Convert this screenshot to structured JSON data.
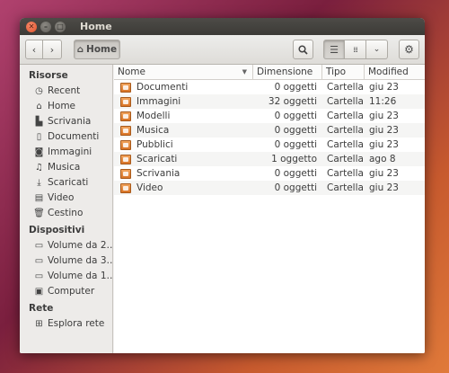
{
  "window": {
    "title": "Home"
  },
  "toolbar": {
    "location_label": "Home"
  },
  "sidebar": {
    "sections": [
      {
        "title": "Risorse",
        "items": [
          {
            "label": "Recent",
            "icon": "clock-icon"
          },
          {
            "label": "Home",
            "icon": "home-icon"
          },
          {
            "label": "Scrivania",
            "icon": "desktop-icon"
          },
          {
            "label": "Documenti",
            "icon": "document-icon"
          },
          {
            "label": "Immagini",
            "icon": "camera-icon"
          },
          {
            "label": "Musica",
            "icon": "music-icon"
          },
          {
            "label": "Scaricati",
            "icon": "download-icon"
          },
          {
            "label": "Video",
            "icon": "film-icon"
          },
          {
            "label": "Cestino",
            "icon": "trash-icon"
          }
        ]
      },
      {
        "title": "Dispositivi",
        "items": [
          {
            "label": "Volume da 2…",
            "icon": "drive-icon"
          },
          {
            "label": "Volume da 3…",
            "icon": "drive-icon"
          },
          {
            "label": "Volume da 1…",
            "icon": "drive-icon"
          },
          {
            "label": "Computer",
            "icon": "computer-icon"
          }
        ]
      },
      {
        "title": "Rete",
        "items": [
          {
            "label": "Esplora rete",
            "icon": "network-icon"
          }
        ]
      }
    ]
  },
  "table": {
    "columns": [
      "Nome",
      "Dimensione",
      "Tipo",
      "Modified"
    ],
    "rows": [
      {
        "name": "Documenti",
        "size": "0 oggetti",
        "type": "Cartella",
        "modified": "giu 23"
      },
      {
        "name": "Immagini",
        "size": "32 oggetti",
        "type": "Cartella",
        "modified": "11:26"
      },
      {
        "name": "Modelli",
        "size": "0 oggetti",
        "type": "Cartella",
        "modified": "giu 23"
      },
      {
        "name": "Musica",
        "size": "0 oggetti",
        "type": "Cartella",
        "modified": "giu 23"
      },
      {
        "name": "Pubblici",
        "size": "0 oggetti",
        "type": "Cartella",
        "modified": "giu 23"
      },
      {
        "name": "Scaricati",
        "size": "1 oggetto",
        "type": "Cartella",
        "modified": "ago 8"
      },
      {
        "name": "Scrivania",
        "size": "0 oggetti",
        "type": "Cartella",
        "modified": "giu 23"
      },
      {
        "name": "Video",
        "size": "0 oggetti",
        "type": "Cartella",
        "modified": "giu 23"
      }
    ]
  },
  "colors": {
    "close_button": "#e0532b",
    "titlebar": "#3c3b37",
    "folder": "#d97426"
  }
}
